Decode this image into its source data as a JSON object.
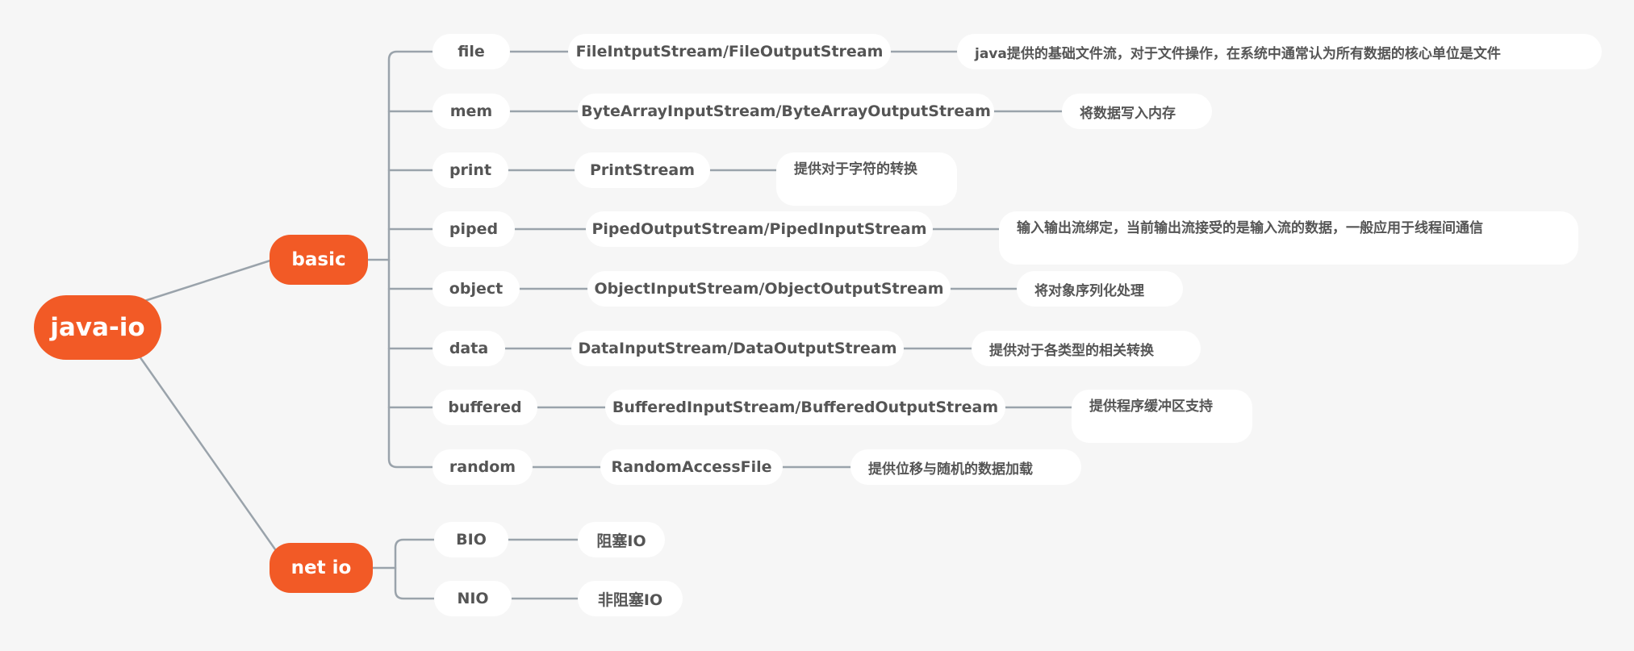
{
  "root": {
    "label": "java-io"
  },
  "branches": [
    {
      "label": "basic",
      "children": [
        {
          "label": "file",
          "class": "FileIntputStream/FileOutputStream",
          "desc": "java提供的基础文件流，对于文件操作，在系统中通常认为所有数据的核心单位是文件"
        },
        {
          "label": "mem",
          "class": "ByteArrayInputStream/ByteArrayOutputStream",
          "desc": "将数据写入内存"
        },
        {
          "label": "print",
          "class": "PrintStream",
          "desc": "提供对于字符的转换"
        },
        {
          "label": "piped",
          "class": "PipedOutputStream/PipedInputStream",
          "desc": "输入输出流绑定，当前输出流接受的是输入流的数据，一般应用于线程间通信"
        },
        {
          "label": "object",
          "class": "ObjectInputStream/ObjectOutputStream",
          "desc": "将对象序列化处理"
        },
        {
          "label": "data",
          "class": "DataInputStream/DataOutputStream",
          "desc": "提供对于各类型的相关转换"
        },
        {
          "label": "buffered",
          "class": "BufferedInputStream/BufferedOutputStream",
          "desc": "提供程序缓冲区支持"
        },
        {
          "label": "random",
          "class": "RandomAccessFile",
          "desc": "提供位移与随机的数据加载"
        }
      ]
    },
    {
      "label": "net io",
      "children": [
        {
          "label": "BIO",
          "desc": "阻塞IO"
        },
        {
          "label": "NIO",
          "desc": "非阻塞IO"
        }
      ]
    }
  ],
  "colors": {
    "accent": "#f25a26",
    "line": "#9aa3ab",
    "node_bg": "#ffffff",
    "node_text": "#555555",
    "background": "#f6f6f6"
  }
}
